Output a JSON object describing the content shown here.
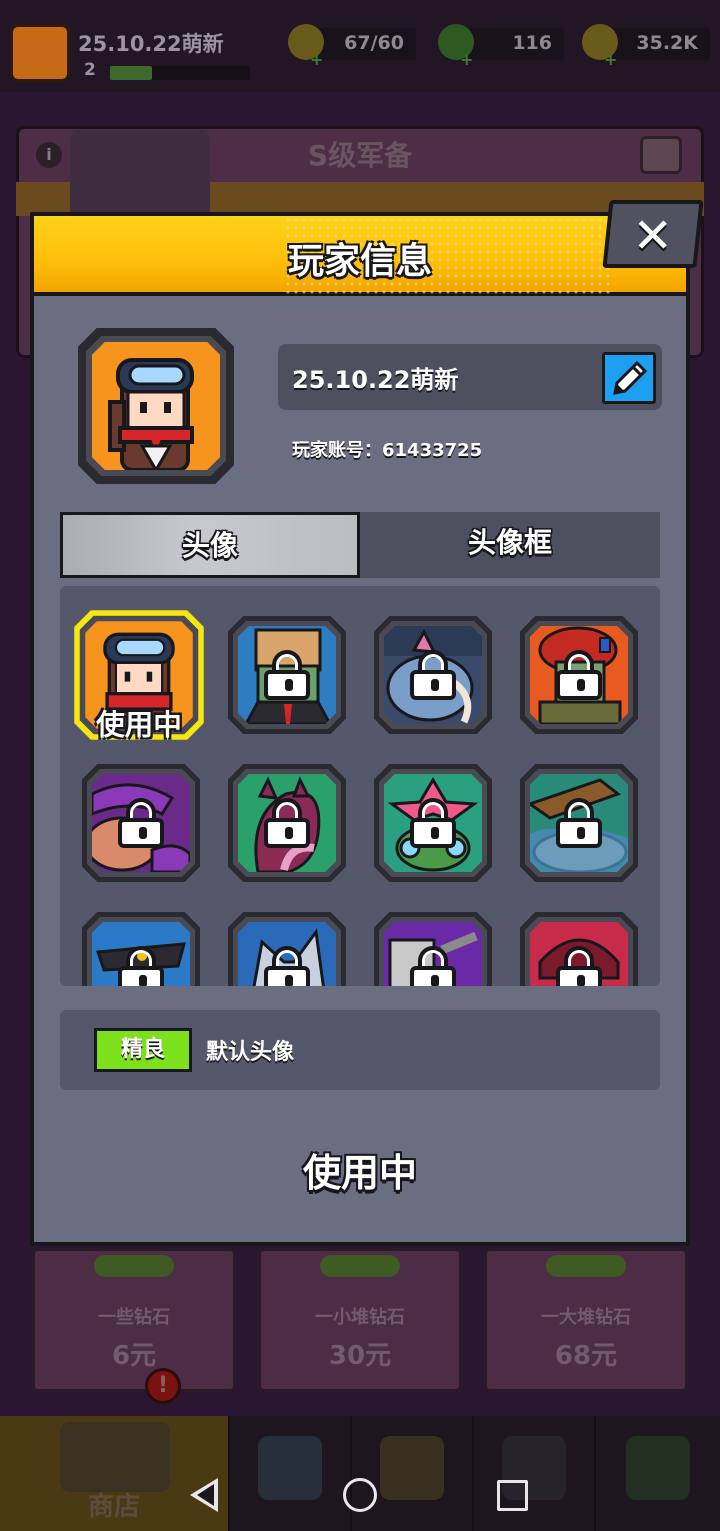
{
  "topbar": {
    "player_name": "25.10.22萌新",
    "level": "2",
    "xp_fraction": 0.3,
    "energy": "67/60",
    "gems": "116",
    "coins": "35.2K"
  },
  "background": {
    "panel_title": "S级军备",
    "shop_items": [
      {
        "name": "一些钻石",
        "price": "6元"
      },
      {
        "name": "一小堆钻石",
        "price": "30元"
      },
      {
        "name": "一大堆钻石",
        "price": "68元"
      }
    ],
    "shop_badge": "!",
    "nav_shop_label": "商店"
  },
  "dialog": {
    "title": "玩家信息",
    "close_label": "✕",
    "player_name": "25.10.22萌新",
    "account_label": "玩家账号：61433725",
    "tabs": [
      {
        "label": "头像",
        "active": true
      },
      {
        "label": "头像框",
        "active": false
      }
    ],
    "in_use_badge": "使用中",
    "selected": {
      "quality": "精良",
      "quality_color": "#7ce01a",
      "description": "默认头像"
    },
    "status": "使用中"
  },
  "colors": {
    "header_yellow": "#ffc412",
    "edit_blue": "#1da0f2",
    "selected_frame": "#f7e710",
    "quality_green": "#7ce01a"
  },
  "icons": {
    "edit": "pencil-icon",
    "close": "close-icon",
    "locked": "lock-icon"
  }
}
